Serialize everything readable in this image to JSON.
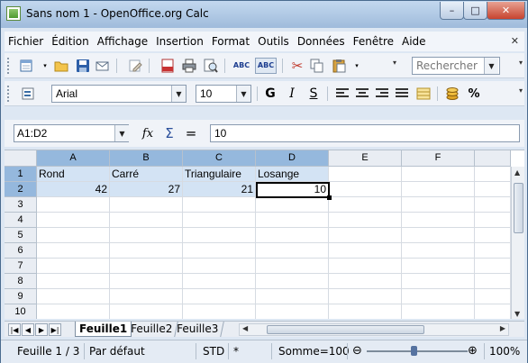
{
  "window": {
    "title": "Sans nom 1 - OpenOffice.org Calc",
    "minimize": "–",
    "maximize": "□",
    "close": "✕"
  },
  "menu": {
    "items": [
      "Fichier",
      "Édition",
      "Affichage",
      "Insertion",
      "Format",
      "Outils",
      "Données",
      "Fenêtre",
      "Aide"
    ],
    "close_doc": "✕"
  },
  "toolbar": {
    "search_placeholder": "Rechercher",
    "icons": [
      "new-document-icon",
      "open-folder-icon",
      "save-icon",
      "email-icon",
      "edit-file-icon",
      "export-pdf-icon",
      "print-icon",
      "print-preview-icon",
      "spellcheck-icon",
      "autospellcheck-icon",
      "cut-icon",
      "copy-icon",
      "paste-icon"
    ]
  },
  "formatting": {
    "font_name": "Arial",
    "font_size": "10",
    "bold": "G",
    "italic": "I",
    "underline": "S",
    "percent": "%"
  },
  "formula_bar": {
    "name_box": "A1:D2",
    "function_wizard": "fx",
    "sum": "Σ",
    "equals": "=",
    "content": "10"
  },
  "sheet": {
    "columns": [
      "A",
      "B",
      "C",
      "D",
      "E",
      "F"
    ],
    "rows": [
      "1",
      "2",
      "3",
      "4",
      "5",
      "6",
      "7",
      "8",
      "9",
      "10"
    ],
    "cells": {
      "A1": "Rond",
      "B1": "Carré",
      "C1": "Triangulaire",
      "D1": "Losange",
      "A2": "42",
      "B2": "27",
      "C2": "21",
      "D2": "10"
    },
    "tabs": [
      "Feuille1",
      "Feuille2",
      "Feuille3"
    ]
  },
  "status": {
    "sheet": "Feuille 1 / 3",
    "style": "Par défaut",
    "mode": "STD",
    "modified": "*",
    "sum": "Somme=100",
    "zoom": "100%",
    "zoom_out": "⊖",
    "zoom_in": "⊕"
  }
}
